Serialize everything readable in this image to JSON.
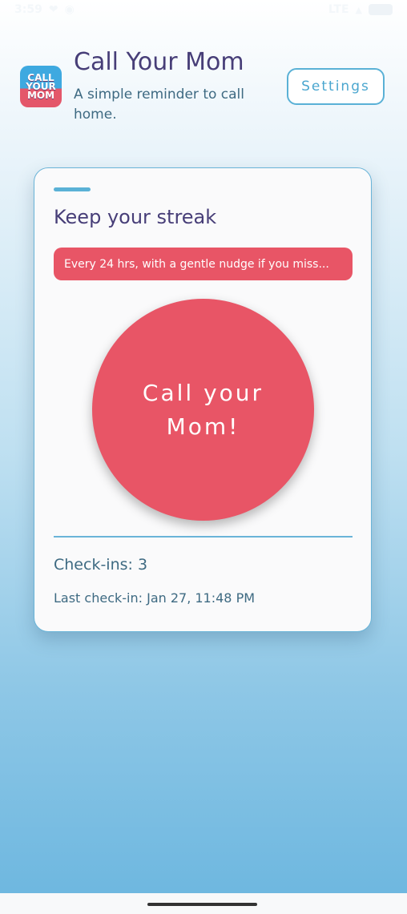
{
  "status_bar": {
    "time": "3:59",
    "network": "LTE"
  },
  "header": {
    "logo_lines": [
      "CALL",
      "YOUR",
      "MOM"
    ],
    "title": "Call Your Mom",
    "subtitle": "A simple reminder to call home.",
    "settings_label": "Settings"
  },
  "card": {
    "title": "Keep your streak",
    "schedule_text": "Every 24 hrs, with a gentle nudge if you miss...",
    "call_button_label": "Call your Mom!",
    "checkins_text": "Check-ins: 3",
    "last_checkin_text": "Last check-in: Jan 27, 11:48 PM"
  },
  "colors": {
    "accent_blue": "#5ab1d6",
    "accent_red": "#e85566",
    "title_purple": "#473e78"
  }
}
